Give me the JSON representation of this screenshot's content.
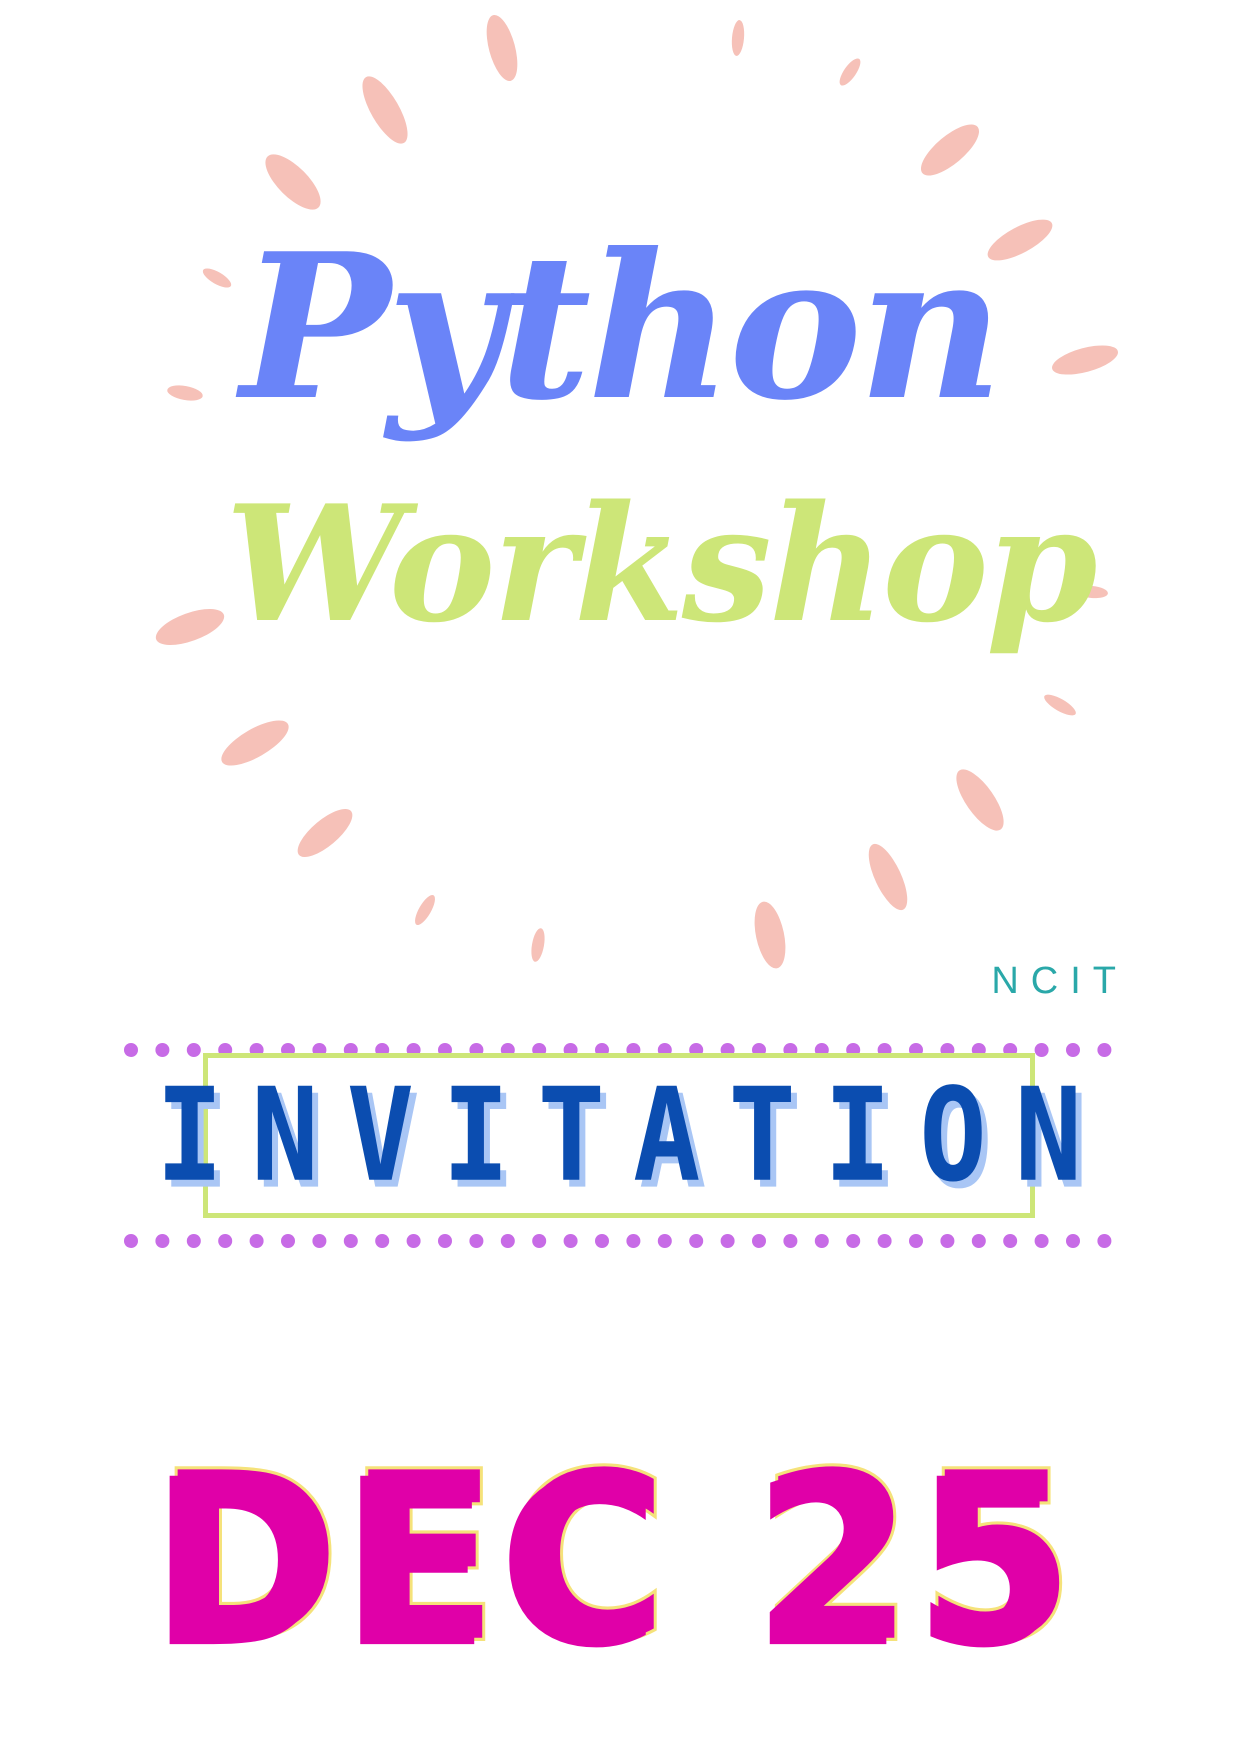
{
  "title_line1": "Python",
  "title_line2": "Workshop",
  "organizer": "NCIT",
  "badge_text": "INVITATION",
  "date_text": "DEC 25",
  "colors": {
    "title_line1": "#6a84f8",
    "title_line2": "#cde678",
    "petals": "#f6c1b8",
    "organizer": "#2aa8a9",
    "dots": "#c76be6",
    "badge_border": "#cde678",
    "badge_text": "#0b4db0",
    "date_fill": "#e000a8",
    "date_outline": "#f5e27a"
  }
}
